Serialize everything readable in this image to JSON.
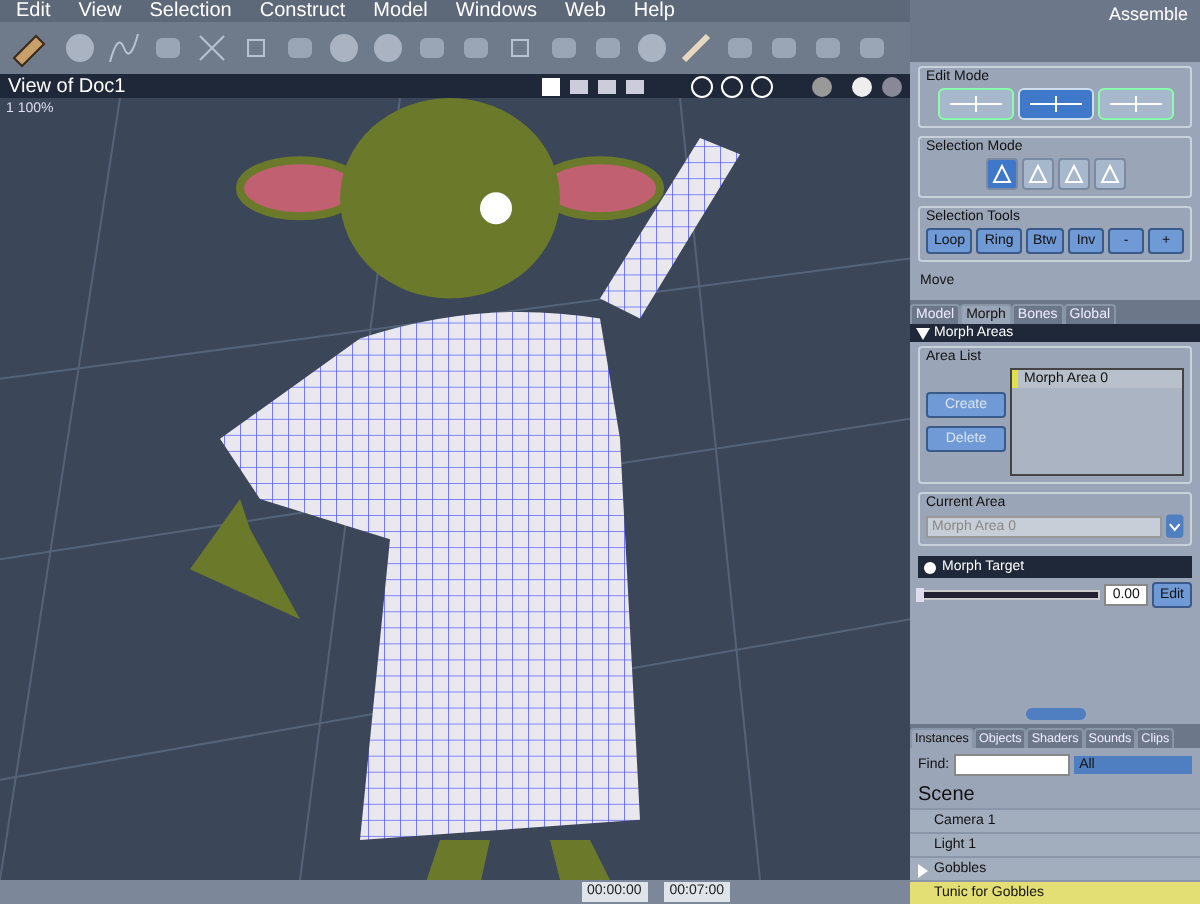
{
  "menu": [
    "Edit",
    "View",
    "Selection",
    "Construct",
    "Model",
    "Windows",
    "Web",
    "Help"
  ],
  "room": "Assemble",
  "view": {
    "title": "View of Doc1",
    "zoom": "1 100%"
  },
  "timeline": {
    "start": "00:00:00",
    "end": "00:07:00"
  },
  "edit_mode": {
    "title": "Edit Mode",
    "modes": [
      {
        "selected": false
      },
      {
        "selected": true
      },
      {
        "selected": false
      }
    ]
  },
  "selection_mode": {
    "title": "Selection Mode",
    "modes": [
      {
        "selected": true
      },
      {
        "selected": false
      },
      {
        "selected": false
      },
      {
        "selected": false
      }
    ]
  },
  "selection_tools": {
    "title": "Selection Tools",
    "buttons": [
      "Loop",
      "Ring",
      "Btw",
      "Inv",
      "-",
      "+"
    ]
  },
  "status": "Move",
  "tabs": [
    {
      "label": "Model",
      "selected": false
    },
    {
      "label": "Morph",
      "selected": true
    },
    {
      "label": "Bones",
      "selected": false
    },
    {
      "label": "Global",
      "selected": false
    }
  ],
  "morph_areas": {
    "title": "Morph Areas",
    "expanded": true,
    "area_list": {
      "title": "Area List",
      "buttons": [
        "Create",
        "Delete"
      ],
      "items": [
        {
          "label": "Morph Area 0",
          "selected": true
        }
      ]
    },
    "current_area": {
      "title": "Current Area",
      "value": "Morph Area 0"
    },
    "morph_target": {
      "title": "Morph Target",
      "level": 0.0,
      "value": "0.00",
      "button": "Edit"
    }
  },
  "browser_tabs": [
    {
      "label": "Instances",
      "selected": true
    },
    {
      "label": "Objects",
      "selected": false
    },
    {
      "label": "Shaders",
      "selected": false
    },
    {
      "label": "Sounds",
      "selected": false
    },
    {
      "label": "Clips",
      "selected": false
    }
  ],
  "find": {
    "label": "Find:",
    "filter": "All"
  },
  "scene": {
    "title": "Scene",
    "items": [
      {
        "label": "Camera 1",
        "kind": "item",
        "selected": false
      },
      {
        "label": "Light 1",
        "kind": "item",
        "selected": false
      },
      {
        "label": "Gobbles",
        "kind": "group",
        "selected": false
      },
      {
        "label": "Tunic for Gobbles",
        "kind": "item",
        "selected": true
      }
    ]
  }
}
